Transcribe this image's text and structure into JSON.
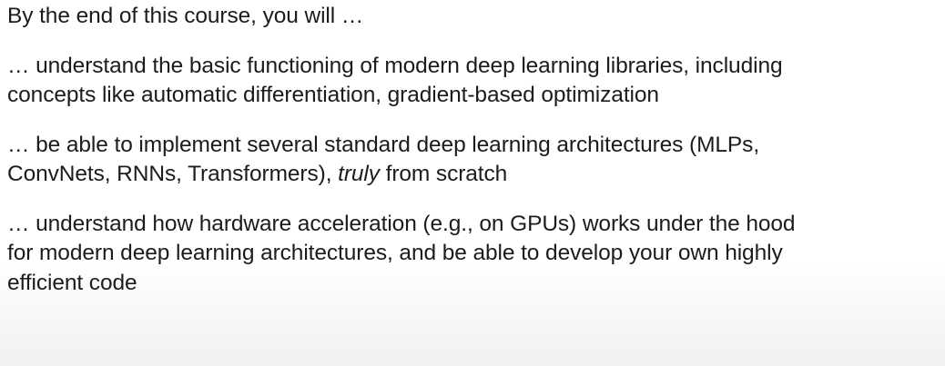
{
  "intro": "By the end of this course, you will …",
  "outcomes": [
    {
      "lines": [
        "… understand the basic functioning of modern deep learning libraries, including",
        "concepts like automatic differentiation, gradient-based optimization"
      ]
    },
    {
      "line1": "… be able to implement several standard deep learning architectures (MLPs,",
      "line2_before": "ConvNets, RNNs, Transformers), ",
      "line2_emphasis": "truly",
      "line2_after": " from scratch"
    },
    {
      "lines": [
        "… understand how hardware acceleration (e.g., on GPUs) works under the hood",
        "for modern deep learning architectures, and be able to develop your own highly",
        "efficient code"
      ]
    }
  ]
}
